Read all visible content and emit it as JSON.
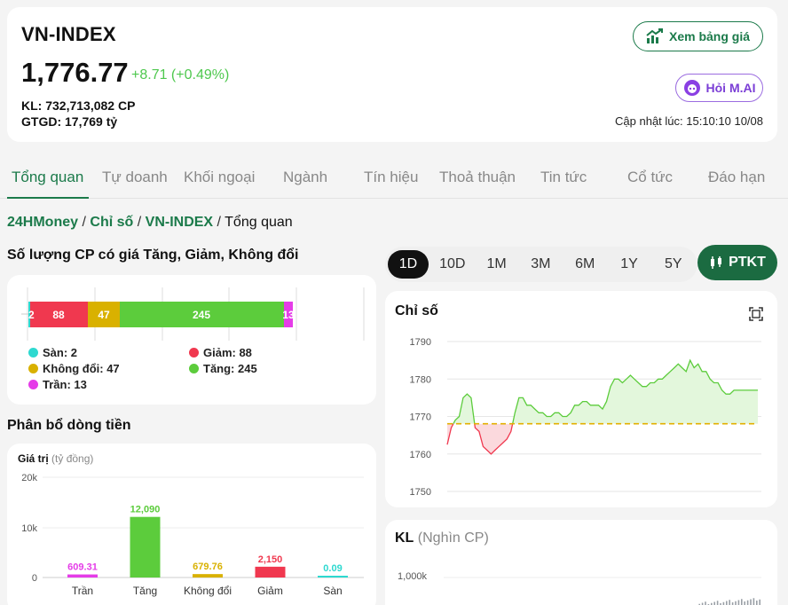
{
  "header": {
    "name": "VN-INDEX",
    "price": "1,776.77",
    "change": "+8.71 (+0.49%)",
    "kl": "KL: 732,713,082 CP",
    "gtgd": "GTGD: 17,769 tỷ",
    "btn_price": "Xem bảng giá",
    "btn_ai": "Hỏi M.AI",
    "updated": "Cập nhật lúc: 15:10:10 10/08"
  },
  "tabs": [
    "Tổng quan",
    "Tự doanh",
    "Khối ngoại",
    "Ngành",
    "Tín hiệu",
    "Thoả thuận",
    "Tin tức",
    "Cổ tức",
    "Đáo hạn"
  ],
  "breadcrumb": {
    "home": "24HMoney",
    "sep": "/",
    "section": "Chỉ số",
    "index": "VN-INDEX",
    "current": "Tổng quan"
  },
  "breadth": {
    "title": "Số lượng CP có giá Tăng, Giảm, Không đổi",
    "bar": {
      "san": 2,
      "giam": 88,
      "khongdoi": 47,
      "tang": 245,
      "tran": 13
    },
    "legend": {
      "san": "Sàn: 2",
      "giam": "Giảm: 88",
      "khongdoi": "Không đổi: 47",
      "tang": "Tăng: 245",
      "tran": "Trần: 13"
    }
  },
  "flow": {
    "title": "Phân bổ dòng tiền",
    "axis_title": "Giá trị",
    "axis_unit": "(tỷ đồng)",
    "yticks": [
      "20k",
      "10k",
      "0"
    ]
  },
  "range": {
    "options": [
      "1D",
      "10D",
      "1M",
      "3M",
      "6M",
      "1Y",
      "5Y"
    ],
    "selected": "1D",
    "ptkt": "PTKT"
  },
  "index_chart": {
    "title": "Chỉ số"
  },
  "kl_chart": {
    "title": "KL",
    "unit": "(Nghìn CP)",
    "ytick": "1,000k"
  },
  "colors": {
    "green": "#5ccc3c",
    "red": "#f0384f",
    "yellow": "#d9b100",
    "cyan": "#2ed9d0",
    "magenta": "#e53ce8",
    "brand": "#1b7a4a"
  },
  "chart_data": [
    {
      "type": "bar",
      "categories": [
        "Trần",
        "Tăng",
        "Không đổi",
        "Giảm",
        "Sàn"
      ],
      "values": [
        609.31,
        12090,
        679.76,
        2150,
        0.09
      ],
      "labels": [
        "609.31",
        "12,090",
        "679.76",
        "2,150",
        "0.09"
      ],
      "colors": [
        "#e53ce8",
        "#5ccc3c",
        "#d9b100",
        "#f0384f",
        "#2ed9d0"
      ],
      "ylim": [
        0,
        20000
      ]
    },
    {
      "type": "area",
      "ylim": [
        1748,
        1791
      ],
      "yticks": [
        "1790",
        "1780",
        "1770",
        "1760",
        "1750"
      ],
      "reference": 1768.06,
      "values": [
        1762.5,
        1767,
        1769,
        1770,
        1775,
        1776,
        1775,
        1767,
        1766,
        1762,
        1761,
        1760,
        1761,
        1762,
        1763,
        1764,
        1766,
        1771,
        1775,
        1775,
        1773,
        1773,
        1772,
        1771,
        1771,
        1770,
        1770,
        1771,
        1771,
        1770,
        1770,
        1771,
        1773,
        1773,
        1774,
        1774,
        1773,
        1773,
        1773,
        1772,
        1774,
        1778,
        1780,
        1780,
        1779,
        1780,
        1781,
        1780,
        1779,
        1778,
        1778,
        1779,
        1779,
        1780,
        1780,
        1781,
        1782,
        1783,
        1784,
        1783,
        1782,
        1785,
        1783,
        1784,
        1782,
        1782,
        1780,
        1779,
        1779,
        1777,
        1776,
        1776,
        1777,
        1777,
        1777,
        1777,
        1777,
        1777,
        1777
      ]
    }
  ]
}
